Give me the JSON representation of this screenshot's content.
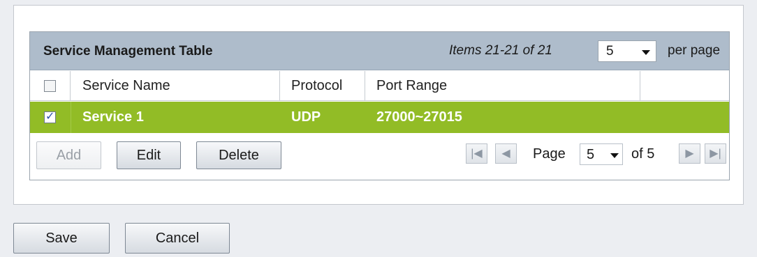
{
  "table": {
    "title": "Service Management Table",
    "items_text": "Items 21-21 of 21",
    "per_page_value": "5",
    "per_page_label": "per page",
    "columns": [
      "Service Name",
      "Protocol",
      "Port Range"
    ],
    "rows": [
      {
        "selected": true,
        "service_name": "Service 1",
        "protocol": "UDP",
        "port_range": "27000~27015"
      }
    ],
    "selected_row_color": "#92bc26"
  },
  "actions": {
    "add_label": "Add",
    "edit_label": "Edit",
    "delete_label": "Delete"
  },
  "pager": {
    "page_label": "Page",
    "page_value": "5",
    "of_label": "of 5",
    "icons": [
      "first-page-icon",
      "previous-page-icon",
      "next-page-icon",
      "last-page-icon"
    ]
  },
  "footer": {
    "save_label": "Save",
    "cancel_label": "Cancel"
  }
}
